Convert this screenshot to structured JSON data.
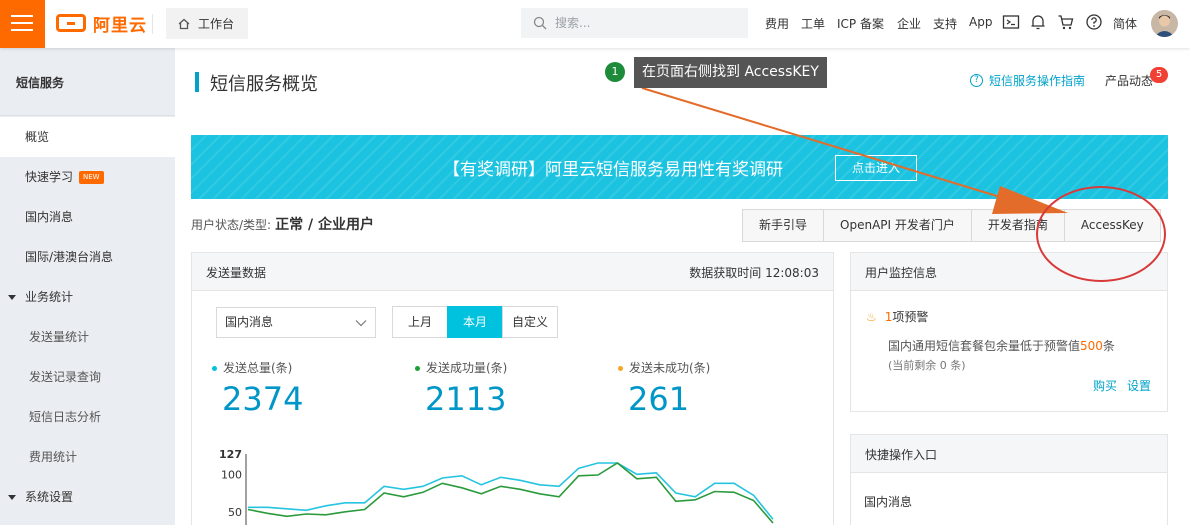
{
  "topbar": {
    "logo_text": "阿里云",
    "workbench_label": "工作台",
    "search_placeholder": "搜索...",
    "nav": [
      "费用",
      "工单",
      "ICP 备案",
      "企业",
      "支持",
      "App"
    ],
    "language": "简体",
    "brand_color": "#ff6a00"
  },
  "sidebar": {
    "title": "短信服务",
    "items": [
      {
        "label": "概览"
      },
      {
        "label": "快速学习",
        "badge": "NEW"
      },
      {
        "label": "国内消息"
      },
      {
        "label": "国际/港澳台消息"
      },
      {
        "label": "业务统计"
      },
      {
        "label": "发送量统计"
      },
      {
        "label": "发送记录查询"
      },
      {
        "label": "短信日志分析"
      },
      {
        "label": "费用统计"
      },
      {
        "label": "系统设置"
      }
    ]
  },
  "header": {
    "title": "短信服务概览",
    "guide_link": "短信服务操作指南",
    "product_news": "产品动态",
    "news_count": "5"
  },
  "banner": {
    "text": "【有奖调研】阿里云短信服务易用性有奖调研",
    "button": "点击进入"
  },
  "user_status": {
    "label": "用户状态/类型:",
    "value": "正常 / 企业用户"
  },
  "buttons": [
    "新手引导",
    "OpenAPI 开发者门户",
    "开发者指南",
    "AccessKey"
  ],
  "send_panel": {
    "title": "发送量数据",
    "fetch_time": "数据获取时间 12:08:03",
    "select_value": "国内消息",
    "ranges": [
      "上月",
      "本月",
      "自定义"
    ],
    "active_range": "本月",
    "stats": [
      {
        "label": "发送总量(条)",
        "value": "2374",
        "color": "#00c1de"
      },
      {
        "label": "发送成功量(条)",
        "value": "2113",
        "color": "#1aa036"
      },
      {
        "label": "发送未成功(条)",
        "value": "261",
        "color": "#f5a623"
      }
    ]
  },
  "chart_data": {
    "type": "line",
    "yticks": [
      "127",
      "100",
      "50"
    ],
    "series": [
      {
        "color": "#25c4e0",
        "values": [
          56,
          56,
          54,
          52,
          58,
          62,
          62,
          84,
          80,
          84,
          95,
          98,
          86,
          96,
          92,
          86,
          84,
          108,
          115,
          115,
          100,
          102,
          75,
          70,
          88,
          88,
          72,
          40
        ]
      },
      {
        "color": "#2a9a3c",
        "values": [
          53,
          48,
          44,
          47,
          46,
          50,
          53,
          75,
          70,
          76,
          88,
          82,
          74,
          84,
          80,
          74,
          70,
          98,
          99,
          115,
          94,
          96,
          64,
          66,
          77,
          76,
          65,
          35
        ]
      }
    ]
  },
  "monitor": {
    "title": "用户监控信息",
    "warn_count": "1",
    "warn_label": "项预警",
    "warn_desc_prefix": "国内通用短信套餐包余量低于预警值",
    "warn_threshold": "500",
    "warn_desc_suffix": "条",
    "remain": "(当前剩余 0 条)",
    "buy": "购买",
    "settings": "设置"
  },
  "quick": {
    "title": "快捷操作入口",
    "item": "国内消息"
  },
  "annotation": {
    "step": "1",
    "tip": "在页面右侧找到 AccessKEY",
    "color": "#e36c2a"
  }
}
